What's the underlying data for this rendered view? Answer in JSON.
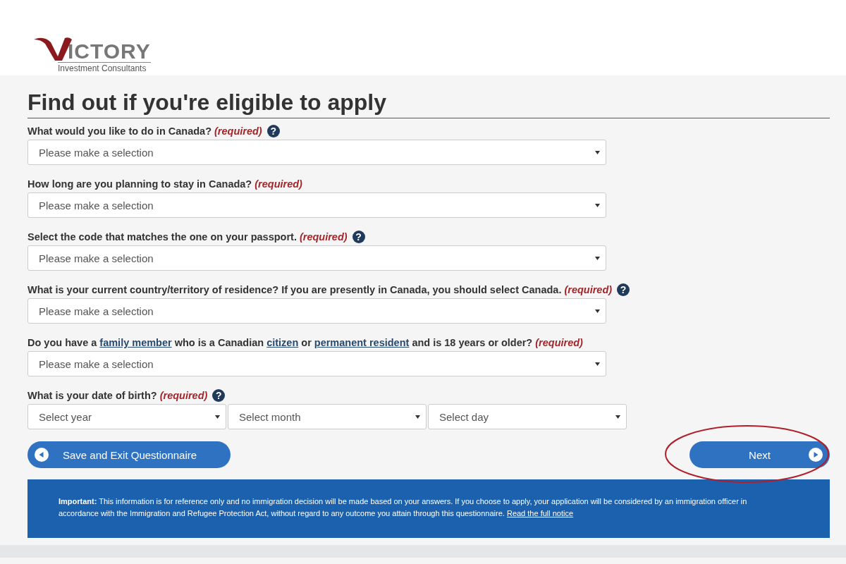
{
  "logo": {
    "wordmark": "ICTORY",
    "tagline": "Investment Consultants"
  },
  "title": "Find out if you're eligible to apply",
  "questions": [
    {
      "label": [
        {
          "kind": "text",
          "text": "What would you like to do in Canada?"
        }
      ],
      "required": "(required)",
      "help": "?",
      "selects": [
        "Please make a selection"
      ]
    },
    {
      "label": [
        {
          "kind": "text",
          "text": "How long are you planning to stay in Canada?"
        }
      ],
      "required": "(required)",
      "selects": [
        "Please make a selection"
      ]
    },
    {
      "label": [
        {
          "kind": "text",
          "text": "Select the code that matches the one on your passport."
        }
      ],
      "required": "(required)",
      "help": "?",
      "selects": [
        "Please make a selection"
      ]
    },
    {
      "label": [
        {
          "kind": "text",
          "text": "What is your current country/territory of residence? If you are presently in Canada, you should select Canada."
        }
      ],
      "required": "(required)",
      "help": "?",
      "selects": [
        "Please make a selection"
      ]
    },
    {
      "label": [
        {
          "kind": "text",
          "text": "Do you have a"
        },
        {
          "kind": "link",
          "text": "family member"
        },
        {
          "kind": "text",
          "text": "who is a Canadian"
        },
        {
          "kind": "link",
          "text": "citizen"
        },
        {
          "kind": "text",
          "text": "or"
        },
        {
          "kind": "link",
          "text": "permanent resident"
        },
        {
          "kind": "text",
          "text": "and is 18 years or older?"
        }
      ],
      "required": "(required)",
      "selects": [
        "Please make a selection"
      ]
    },
    {
      "label": [
        {
          "kind": "text",
          "text": "What is your date of birth?"
        }
      ],
      "required": "(required)",
      "help": "?",
      "selects": [
        "Select year",
        "Select month",
        "Select day"
      ]
    }
  ],
  "buttons": [
    {
      "kind": "back",
      "label": "Save and Exit Questionnaire",
      "circled": false
    },
    {
      "kind": "next",
      "label": "Next",
      "circled": true
    }
  ],
  "notice": {
    "text": "**Important:** This information is for reference only and no immigration decision will be made based on your answers. If you choose to apply, your application will be considered by an immigration officer in accordance with the Immigration and Refugee Protection Act, without regard to any outcome you attain through this questionnaire.",
    "link": "Read the full notice"
  }
}
